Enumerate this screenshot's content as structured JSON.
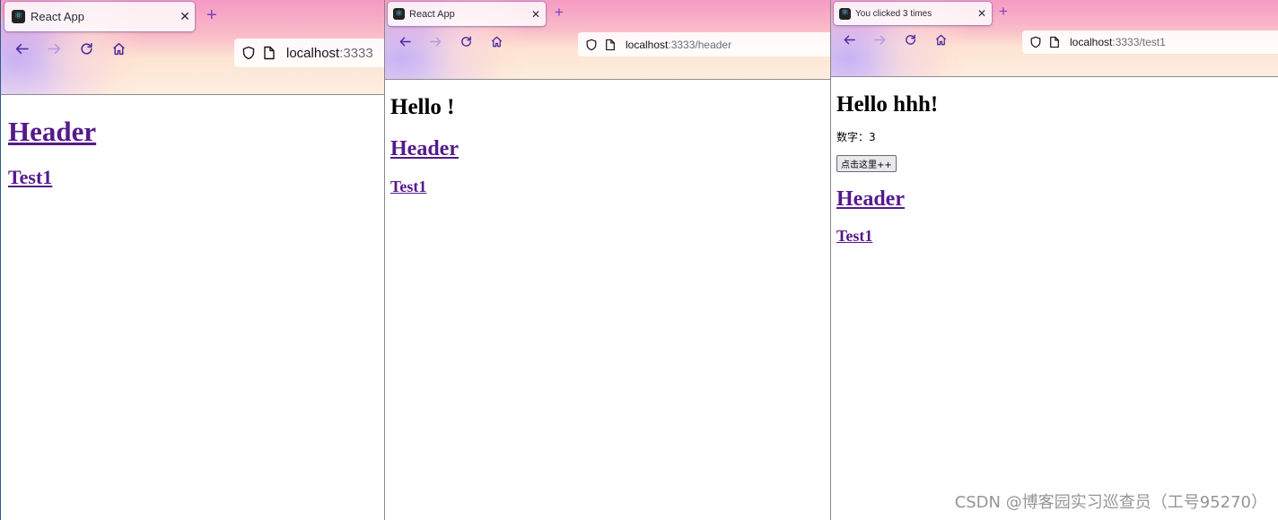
{
  "windows": [
    {
      "tab_title": "React App",
      "url_host": "localhost",
      "url_rest": ":3333",
      "links": [
        "Header",
        "Test1"
      ]
    },
    {
      "tab_title": "React App",
      "url_host": "localhost",
      "url_rest": ":3333/header",
      "heading": "Hello !",
      "links": [
        "Header",
        "Test1"
      ]
    },
    {
      "tab_title": "You clicked 3 times",
      "url_host": "localhost",
      "url_rest": ":3333/test1",
      "heading": "Hello hhh!",
      "counter_text": "数字：3",
      "button_label": "点击这里++",
      "links": [
        "Header",
        "Test1"
      ]
    }
  ],
  "icons": {
    "close": "close-icon",
    "new_tab": "plus-icon",
    "back": "arrow-left-icon",
    "forward": "arrow-right-icon",
    "reload": "reload-icon",
    "home": "home-icon",
    "shield": "shield-icon",
    "page": "page-icon"
  },
  "watermark": "CSDN @博客园实习巡查员（工号95270）",
  "colors": {
    "link": "#551a8b",
    "nav_icon": "#4a2ca3",
    "new_tab": "#7a3fc8"
  }
}
